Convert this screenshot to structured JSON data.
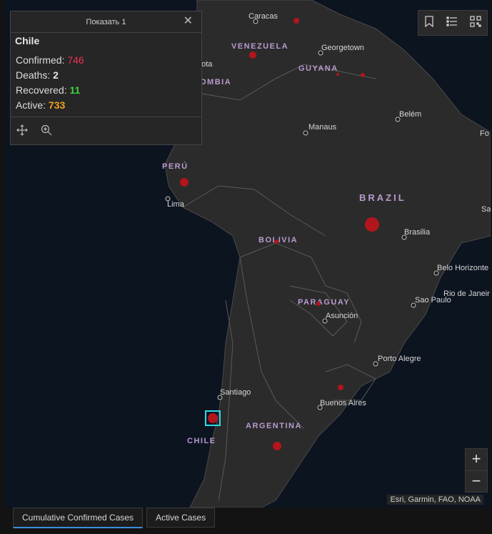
{
  "popup": {
    "header": "Показать 1",
    "title": "Chile",
    "rows": [
      {
        "label": "Confirmed: ",
        "value": "746",
        "color": "#e8344e"
      },
      {
        "label": "Deaths: ",
        "value": "2",
        "color": "#e6e6e6"
      },
      {
        "label": "Recovered: ",
        "value": "11",
        "color": "#3fd13f"
      },
      {
        "label": "Active: ",
        "value": "733",
        "color": "#f0a020"
      }
    ]
  },
  "map": {
    "cities": [
      "Caracas",
      "Georgetown",
      "Belém",
      "Fo",
      "Manaus",
      "gota",
      "Lima",
      "Sa",
      "Brasilia",
      "Belo Horizonte",
      "Rio de Janeir",
      "Sao Paulo",
      "Asunción",
      "Porto Alegre",
      "Santiago",
      "Buenos Aires"
    ],
    "countries": [
      "VENEZUELA",
      "GUYANA",
      "OMBIA",
      "PERÚ",
      "BRAZIL",
      "BOLIVIA",
      "PARAGUAY",
      "ARGENTINA",
      "CHILE"
    ],
    "attribution": "Esri, Garmin, FAO, NOAA",
    "case_marker_color": "#b3151c",
    "selection_color": "#2fd9e6"
  },
  "zoom": {
    "in": "+",
    "out": "−"
  },
  "tabs": [
    "Cumulative Confirmed Cases",
    "Active Cases"
  ]
}
